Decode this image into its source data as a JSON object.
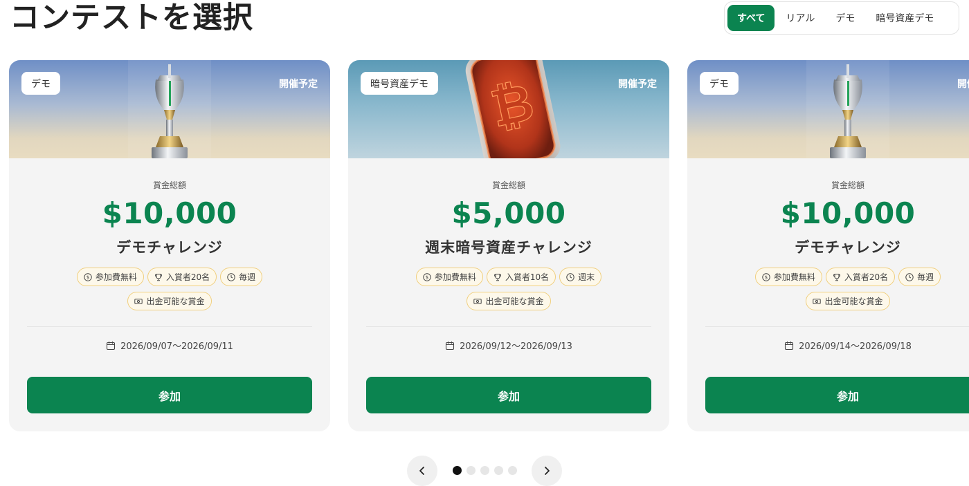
{
  "page": {
    "title": "コンテストを選択"
  },
  "filters": {
    "items": [
      {
        "label": "すべて",
        "active": true
      },
      {
        "label": "リアル",
        "active": false
      },
      {
        "label": "デモ",
        "active": false
      },
      {
        "label": "暗号資産デモ",
        "active": false
      }
    ]
  },
  "cards": [
    {
      "type_badge": "デモ",
      "status": "開催予定",
      "banner_icon": "trophy-image",
      "prize_label": "賞金総額",
      "prize_amount": "$10,000",
      "name": "デモチャレンジ",
      "tags": [
        {
          "icon": "dollar-circle-icon",
          "label": "参加費無料"
        },
        {
          "icon": "trophy-icon",
          "label": "入賞者20名"
        },
        {
          "icon": "clock-icon",
          "label": "毎週"
        },
        {
          "icon": "cash-icon",
          "label": "出金可能な賞金"
        }
      ],
      "date_range": "2026/09/07〜2026/09/11",
      "join_label": "参加"
    },
    {
      "type_badge": "暗号資産デモ",
      "status": "開催予定",
      "banner_icon": "bitcoin-image",
      "prize_label": "賞金総額",
      "prize_amount": "$5,000",
      "name": "週末暗号資産チャレンジ",
      "tags": [
        {
          "icon": "dollar-circle-icon",
          "label": "参加費無料"
        },
        {
          "icon": "trophy-icon",
          "label": "入賞者10名"
        },
        {
          "icon": "clock-icon",
          "label": "週末"
        },
        {
          "icon": "cash-icon",
          "label": "出金可能な賞金"
        }
      ],
      "date_range": "2026/09/12〜2026/09/13",
      "join_label": "参加"
    },
    {
      "type_badge": "デモ",
      "status": "開催予定",
      "banner_icon": "trophy-image",
      "prize_label": "賞金総額",
      "prize_amount": "$10,000",
      "name": "デモチャレンジ",
      "tags": [
        {
          "icon": "dollar-circle-icon",
          "label": "参加費無料"
        },
        {
          "icon": "trophy-icon",
          "label": "入賞者20名"
        },
        {
          "icon": "clock-icon",
          "label": "毎週"
        },
        {
          "icon": "cash-icon",
          "label": "出金可能な賞金"
        }
      ],
      "date_range": "2026/09/14〜2026/09/18",
      "join_label": "参加"
    }
  ],
  "pagination": {
    "total_pages": 5,
    "current_page": 1
  },
  "colors": {
    "accent": "#0b8450",
    "tag_border": "#f0cf7e",
    "card_bg": "#f4f4f4"
  }
}
